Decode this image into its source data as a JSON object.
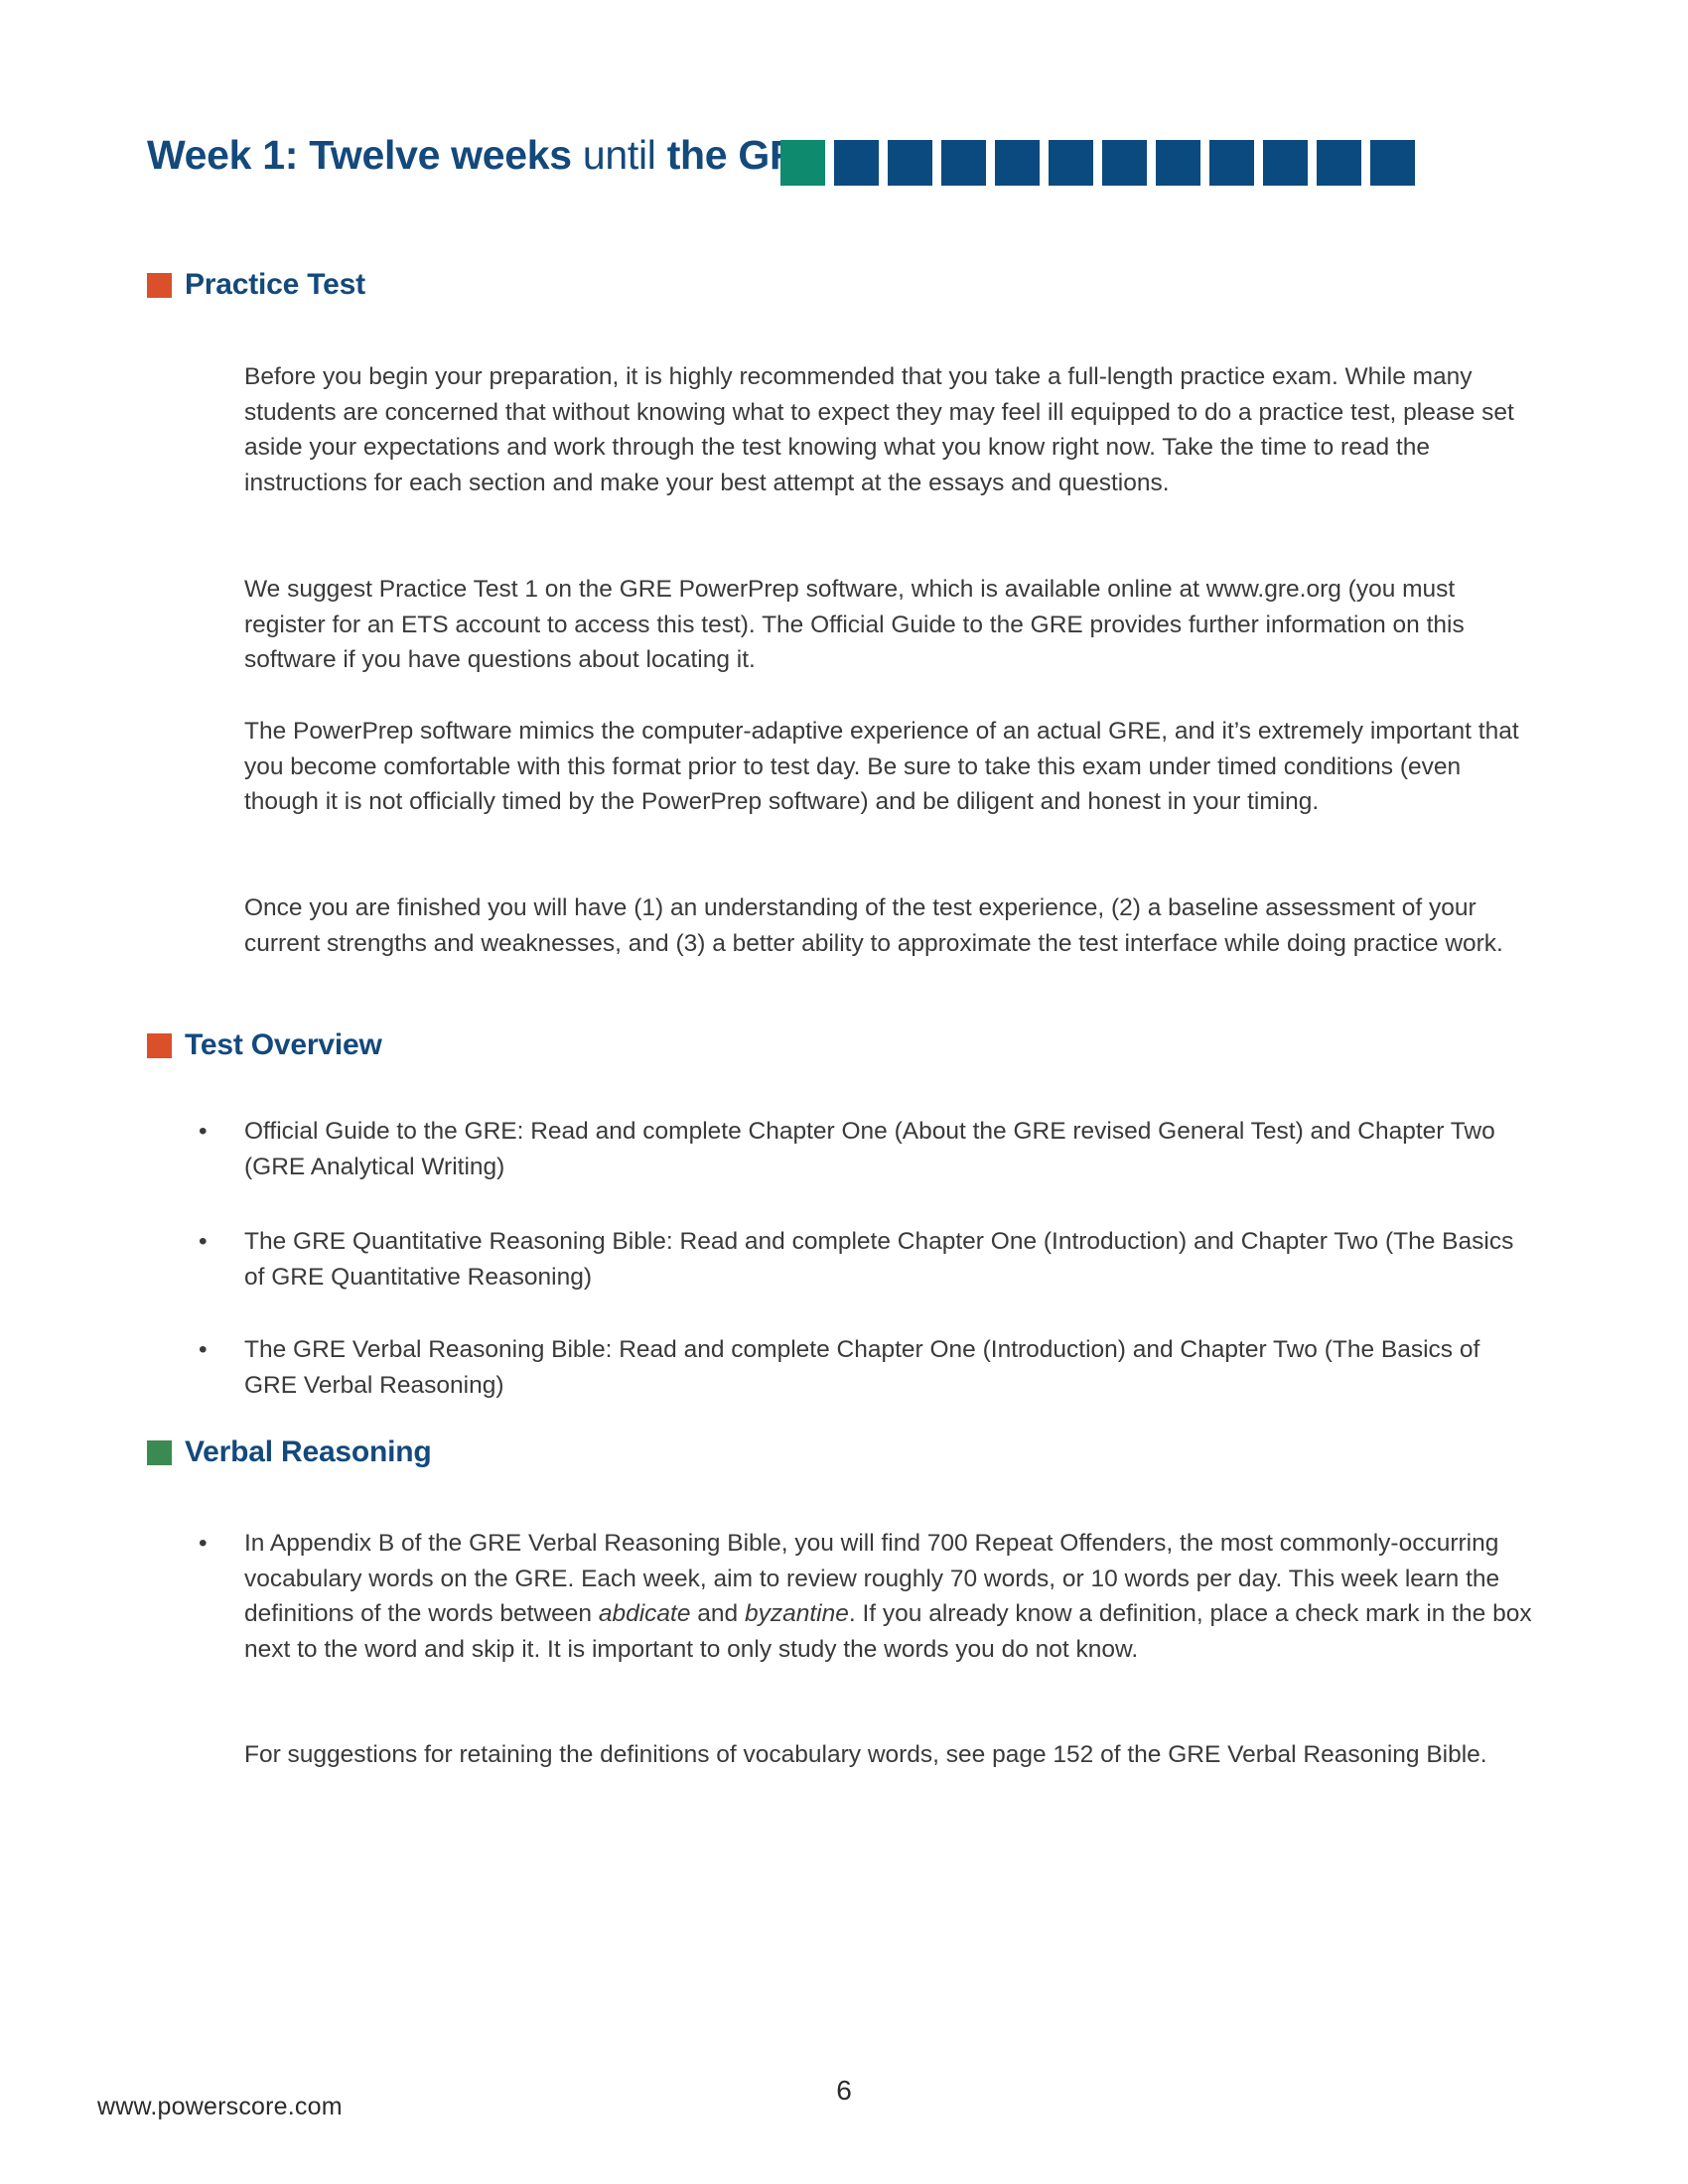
{
  "document": {
    "header": {
      "title_part_1": "Week 1: Twelve weeks",
      "title_part_2": " until ",
      "title_part_3": "the GRE",
      "accent_color": "#14497C",
      "blocks": [
        {
          "name": "progress-block-1",
          "color": "#0E8A6E"
        },
        {
          "name": "progress-block-2",
          "color": "#0B4A7F"
        },
        {
          "name": "progress-block-3",
          "color": "#0B4A7F"
        },
        {
          "name": "progress-block-4",
          "color": "#0B4A7F"
        },
        {
          "name": "progress-block-5",
          "color": "#0B4A7F"
        },
        {
          "name": "progress-block-6",
          "color": "#0B4A7F"
        },
        {
          "name": "progress-block-7",
          "color": "#0B4A7F"
        },
        {
          "name": "progress-block-8",
          "color": "#0B4A7F"
        },
        {
          "name": "progress-block-9",
          "color": "#0B4A7F"
        },
        {
          "name": "progress-block-10",
          "color": "#0B4A7F"
        },
        {
          "name": "progress-block-11",
          "color": "#0B4A7F"
        },
        {
          "name": "progress-block-12",
          "color": "#0B4A7F"
        }
      ]
    },
    "sections": {
      "practice_test": {
        "heading": "Practice Test",
        "bullet_color": "#D9502A",
        "paragraphs": [
          "Before you begin your preparation, it is highly recommended that you take a full-length practice exam. While many students are concerned that without knowing what to expect they may feel ill equipped to do a practice test, please set aside your expectations and work through the test knowing what you know right now. Take the time to read the instructions for each section and make your best attempt at the essays and questions.",
          "We suggest Practice Test 1 on the GRE PowerPrep software, which is available online at www.gre.org (you must register for an ETS account to access this test). The Official Guide to the GRE provides further information on this software if you have questions about locating it.",
          "The PowerPrep software mimics the computer-adaptive experience of an actual GRE, and it’s extremely important that you become comfortable with this format prior to test day. Be sure to take this exam under timed conditions (even though it is not officially timed by the PowerPrep software) and be diligent and honest in your timing.",
          "Once you are finished you will have (1) an understanding of the test experience, (2) a baseline assessment of your current strengths and weaknesses, and (3) a better ability to approximate the test interface while doing practice work."
        ]
      },
      "test_overview": {
        "heading": "Test Overview",
        "bullet_color": "#D9502A",
        "bullet_marker": "•",
        "bullets": [
          "Official Guide to the GRE: Read and complete Chapter One (About the GRE revised General Test) and Chapter Two (GRE Analytical Writing)",
          "The GRE Quantitative Reasoning Bible: Read and complete Chapter One (Introduction) and Chapter Two (The Basics of GRE Quantitative Reasoning)",
          "The GRE Verbal Reasoning Bible: Read and complete Chapter One (Introduction) and Chapter Two (The Basics of GRE Verbal Reasoning)"
        ]
      },
      "verbal_reasoning": {
        "heading": "Verbal Reasoning",
        "bullet_color": "#3B8A52",
        "bullet_marker": "•",
        "bullet_text_before_italic_1": "In Appendix B of the GRE Verbal Reasoning Bible, you will find 700 Repeat Offenders, the most commonly-occurring vocabulary words on the GRE. Each week, aim to review roughly 70 words, or 10 words per day. This week learn the definitions of the words between ",
        "italic_word_1": "abdicate",
        "bullet_text_between_italics": " and ",
        "italic_word_2": "byzantine",
        "bullet_text_after_italic": ". If you already know a definition, place a check mark in the box next to the word and skip it. It is important to only study the words you do not know.",
        "closing_paragraph": "For suggestions for retaining the definitions of vocabulary words, see page 152 of the GRE Verbal Reasoning Bible."
      }
    },
    "footer": {
      "url": "www.powerscore.com",
      "page_number": "6"
    }
  }
}
